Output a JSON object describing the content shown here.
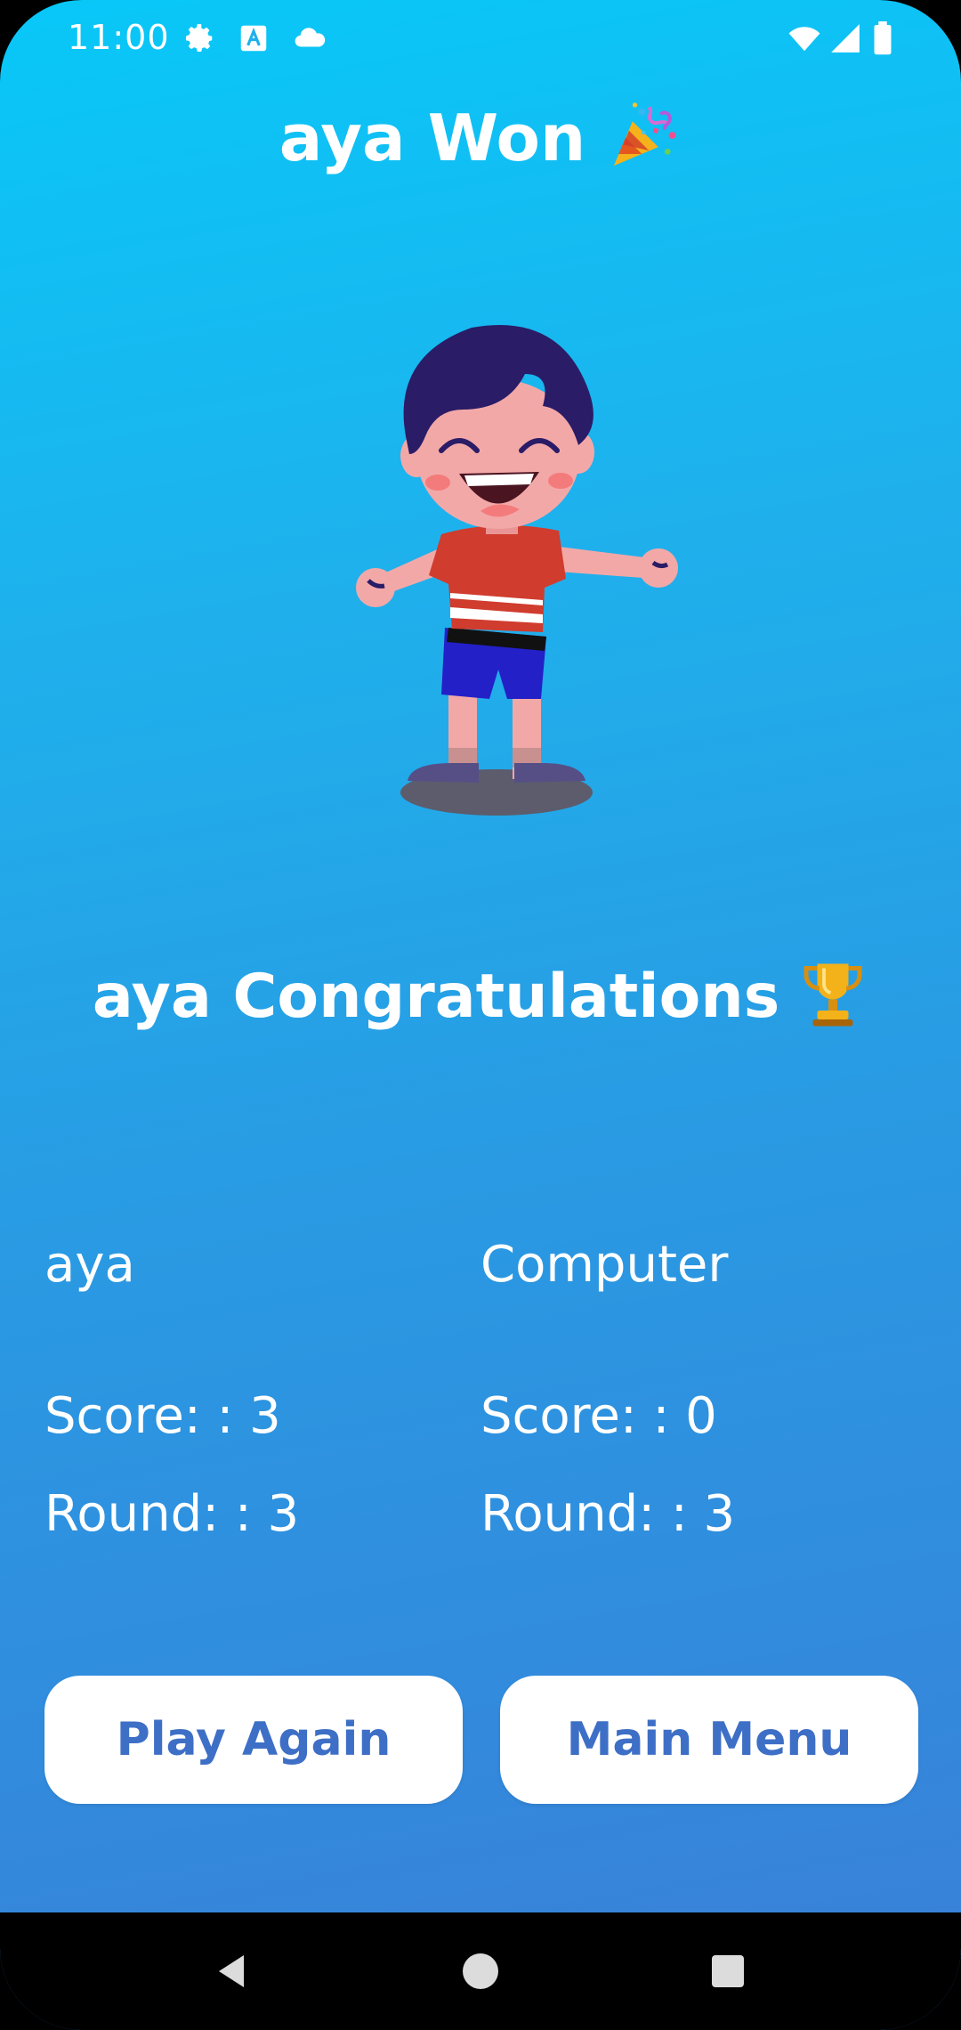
{
  "status_bar": {
    "time": "11:00",
    "left_icons": [
      "gear-icon",
      "text-a-icon",
      "cloud-icon"
    ],
    "right_icons": [
      "wifi-icon",
      "signal-icon",
      "battery-icon"
    ]
  },
  "header": {
    "title": "aya Won",
    "emoji": "🎉"
  },
  "illustration": {
    "subject": "happy-boy-icon"
  },
  "congrats": {
    "text": "aya Congratulations",
    "emoji": "🏆"
  },
  "players": [
    {
      "name": "aya",
      "score": "Score: : 3",
      "round": "Round: : 3"
    },
    {
      "name": "Computer",
      "score": "Score: : 0",
      "round": "Round: : 3"
    }
  ],
  "buttons": {
    "play_again": "Play Again",
    "main_menu": "Main Menu"
  },
  "colors": {
    "gradient_top": "#08c8f8",
    "gradient_bottom": "#3a7fd8",
    "button_text": "#3e6fc6",
    "button_bg": "#ffffff"
  }
}
